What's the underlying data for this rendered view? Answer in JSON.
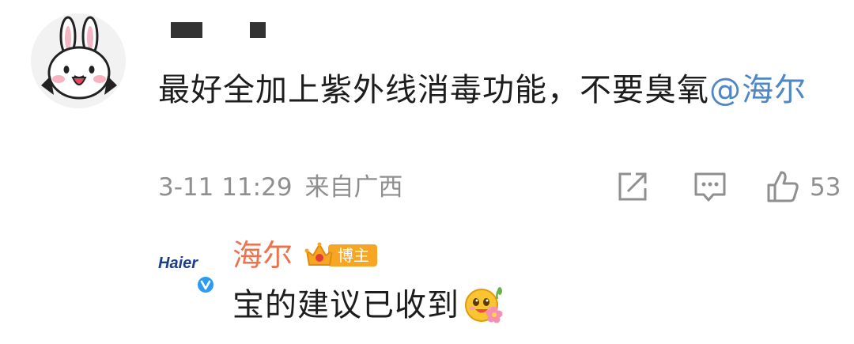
{
  "comment": {
    "text": "最好全加上紫外线消毒功能，不要臭氧",
    "mention": "@海尔",
    "time": "3-11 11:29",
    "location": "来自广西",
    "like_count": "53"
  },
  "reply": {
    "author": "海尔",
    "badge_label": "博主",
    "avatar_logo": "Haier",
    "text": "宝的建议已收到"
  },
  "icons": {
    "share": "share-icon",
    "reply": "comment-icon",
    "like": "thumb-up-icon",
    "verified": "verified-icon",
    "crown": "crown-icon",
    "emoji": "flower-face-emoji"
  },
  "colors": {
    "mention": "#4f86c6",
    "author": "#eb7350",
    "badge": "#f6a623",
    "meta": "#8f8f8f",
    "verified": "#2d9cf0"
  }
}
